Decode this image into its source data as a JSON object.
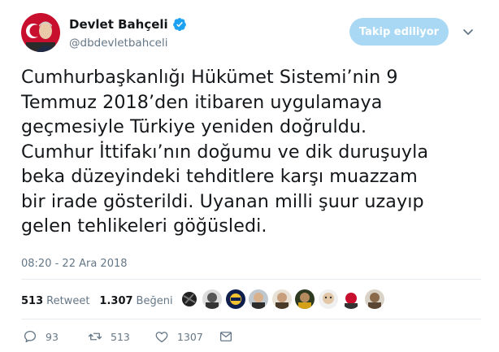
{
  "author": {
    "name": "Devlet Bahçeli",
    "handle": "@dbdevletbahceli",
    "verified": true
  },
  "follow_button": {
    "label": "Takip ediliyor",
    "color": "#a8d8f4"
  },
  "tweet": {
    "lines": [
      "Cumhurbaşkanlığı Hükümet Sistemi’nin 9",
      "Temmuz 2018’den itibaren uygulamaya",
      "geçmesiyle Türkiye yeniden doğruldu.",
      "Cumhur İttifakı’nın doğumu ve dik duruşuyla",
      "beka düzeyindeki tehditlere karşı muazzam",
      "bir irade gösterildi. Uyanan milli şuur uzayıp",
      "gelen tehlikeleri göğüsledi."
    ],
    "timestamp": "08:20 - 22 Ara 2018"
  },
  "stats": {
    "retweets_count": "513",
    "retweets_label": "Retweet",
    "likes_count": "1.307",
    "likes_label": "Beğeni"
  },
  "actions": {
    "reply_count": "93",
    "retweet_count": "513",
    "like_count": "1307"
  },
  "colors": {
    "text": "#14171a",
    "secondary": "#657786",
    "verified": "#1da1f2",
    "divider": "#e6ecf0"
  }
}
